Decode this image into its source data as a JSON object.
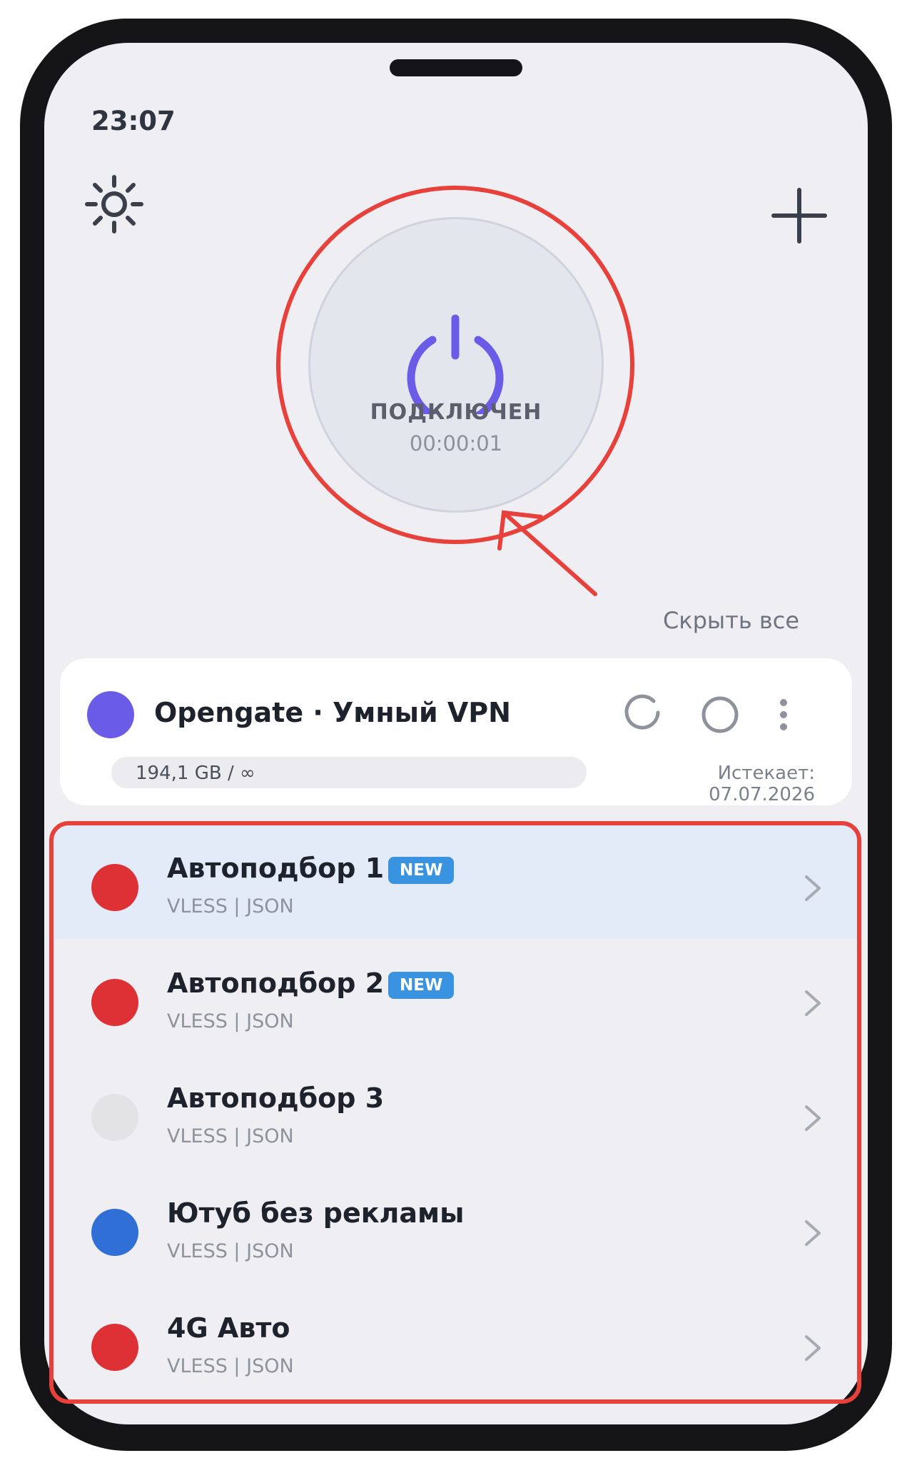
{
  "status_bar": {
    "time": "23:07"
  },
  "header": {
    "settings_icon": "sun-gear-icon",
    "add_icon": "plus-icon"
  },
  "connection": {
    "status": "ПОДКЛЮЧЕН",
    "timer": "00:00:01",
    "power_icon": "power-icon",
    "accent_color": "#6b5ce7"
  },
  "hide_all_label": "Скрыть все",
  "subscription": {
    "name": "Opengate · Умный VPN",
    "dot_color": "#6b5ce7",
    "usage": "194,1 GB / ∞",
    "expires": "Истекает: 07.07.2026",
    "refresh_icon": "refresh-icon",
    "toggle_icon": "circle-icon",
    "menu_icon": "more-vertical-icon"
  },
  "servers": [
    {
      "name": "Автоподбор 1",
      "protocol": "VLESS | JSON",
      "badge": "NEW",
      "dot_color": "#de3136",
      "active": true
    },
    {
      "name": "Автоподбор 2",
      "protocol": "VLESS | JSON",
      "badge": "NEW",
      "dot_color": "#de3136",
      "active": false
    },
    {
      "name": "Автоподбор 3",
      "protocol": "VLESS | JSON",
      "badge": "",
      "dot_color": "#e3e3e5",
      "active": false
    },
    {
      "name": "Ютуб без рекламы",
      "protocol": "VLESS | JSON",
      "badge": "",
      "dot_color": "#2f6fd6",
      "active": false
    },
    {
      "name": "4G Авто",
      "protocol": "VLESS | JSON",
      "badge": "",
      "dot_color": "#de3136",
      "active": false
    }
  ],
  "annotation_color": "#e8403a"
}
